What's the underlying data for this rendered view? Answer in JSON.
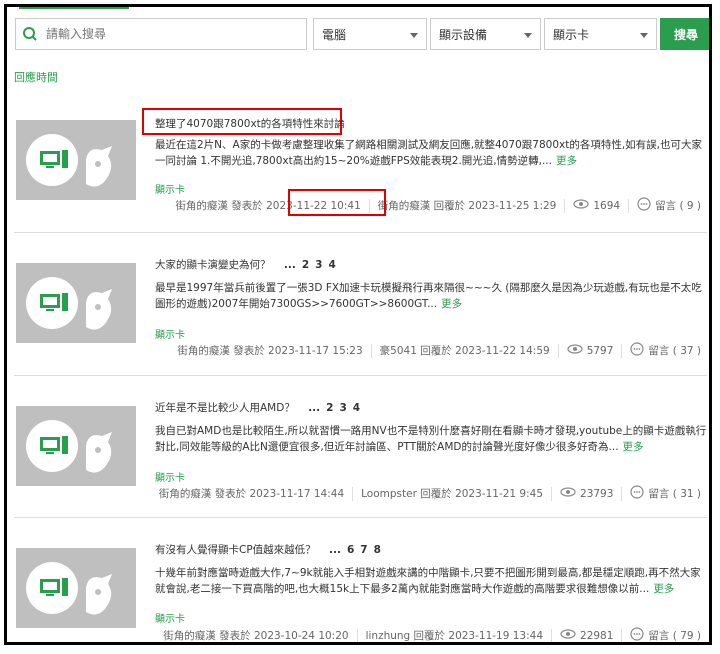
{
  "search": {
    "placeholder": "請輸入搜尋",
    "filter_category": "電腦",
    "filter_subcategory": "顯示設備",
    "filter_item": "顯示卡",
    "button_label": "搜尋"
  },
  "sort_label": "回應時間",
  "posts": [
    {
      "title": "整理了4070跟7800xt的各項特性來討論",
      "pages": [],
      "excerpt": "最近在這2片N、A家的卡做考慮整理收集了網路相關測試及網友回應,就整4070跟7800xt的各項特性,如有誤,也可大家一同討論 1.不開光追,7800xt高出約15~20%遊戲FPS效能表現2.開光追,情勢逆轉,...",
      "more": "更多",
      "category": "顯示卡",
      "author_posted": "街角的癡漢 發表於",
      "posted_time": "2023-11-22 10:41",
      "replied": "街角的癡漢 回覆於 2023-11-25 1:29",
      "views": "1694",
      "comments": "留言 ( 9 )"
    },
    {
      "title": "大家的顯卡演變史為何？",
      "pages": [
        "...",
        "2",
        "3",
        "4"
      ],
      "excerpt": "最早是1997年當兵前後置了一張3D FX加速卡玩模擬飛行再來隔很~~~久 (隔那麼久是因為少玩遊戲,有玩也是不太吃圖形的遊戲)2007年開始7300GS>>7600GT>>8600GT...",
      "more": "更多",
      "category": "顯示卡",
      "author_posted": "街角的癡漢 發表於 2023-11-17 15:23",
      "posted_time": "",
      "replied": "豪5041 回覆於 2023-11-22 14:59",
      "views": "5797",
      "comments": "留言 ( 37 )"
    },
    {
      "title": "近年是不是比較少人用AMD？",
      "pages": [
        "...",
        "2",
        "3",
        "4"
      ],
      "excerpt": "我自已對AMD也是比較陌生,所以就習慣一路用NV也不是特別什麼喜好剛在看顯卡時才發現,youtube上的顯卡遊戲執行對比,同效能等級的A比N還便宜很多,但近年討論區、PTT關於AMD的討論聲光度好像少很多好奇為...",
      "more": "更多",
      "category": "顯示卡",
      "author_posted": "街角的癡漢 發表於 2023-11-17 14:44",
      "posted_time": "",
      "replied": "Loompster 回覆於 2023-11-21 9:45",
      "views": "23793",
      "comments": "留言 ( 31 )"
    },
    {
      "title": "有沒有人覺得顯卡CP值越來越低？",
      "pages": [
        "...",
        "6",
        "7",
        "8"
      ],
      "excerpt": "十幾年前對應當時遊戲大作,7~9k就能入手相對遊戲來講的中階顯卡,只要不把圖形開到最高,都是穩定順跑,再不然大家就會說,老二接一下買高階的吧,也大概15k上下最多2萬內就能對應當時大作遊戲的高階要求很難想像以前...",
      "more": "更多",
      "category": "顯示卡",
      "author_posted": "街角的癡漢 發表於 2023-10-24 10:20",
      "posted_time": "",
      "replied": "linzhung 回覆於 2023-11-19 13:44",
      "views": "22981",
      "comments": "留言 ( 79 )"
    }
  ]
}
